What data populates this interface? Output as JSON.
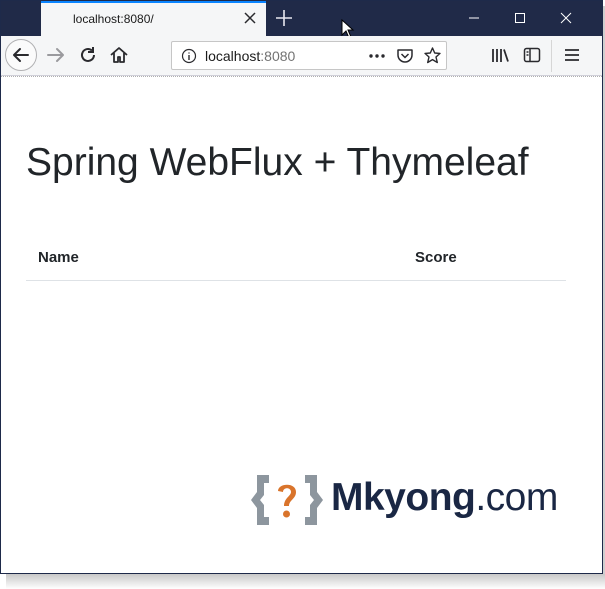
{
  "browser": {
    "tab_title": "localhost:8080/",
    "url_host": "localhost",
    "url_port": ":8080"
  },
  "page": {
    "title": "Spring WebFlux + Thymeleaf",
    "table": {
      "columns": [
        "Name",
        "Score"
      ],
      "rows": []
    }
  },
  "watermark": {
    "brand": "Mkyong",
    "suffix": ".com"
  },
  "colors": {
    "titlebar": "#202a48",
    "tab_accent": "#0a84ff",
    "text": "#212529",
    "logo_orange": "#d9742b",
    "logo_gray": "#8d969e"
  }
}
